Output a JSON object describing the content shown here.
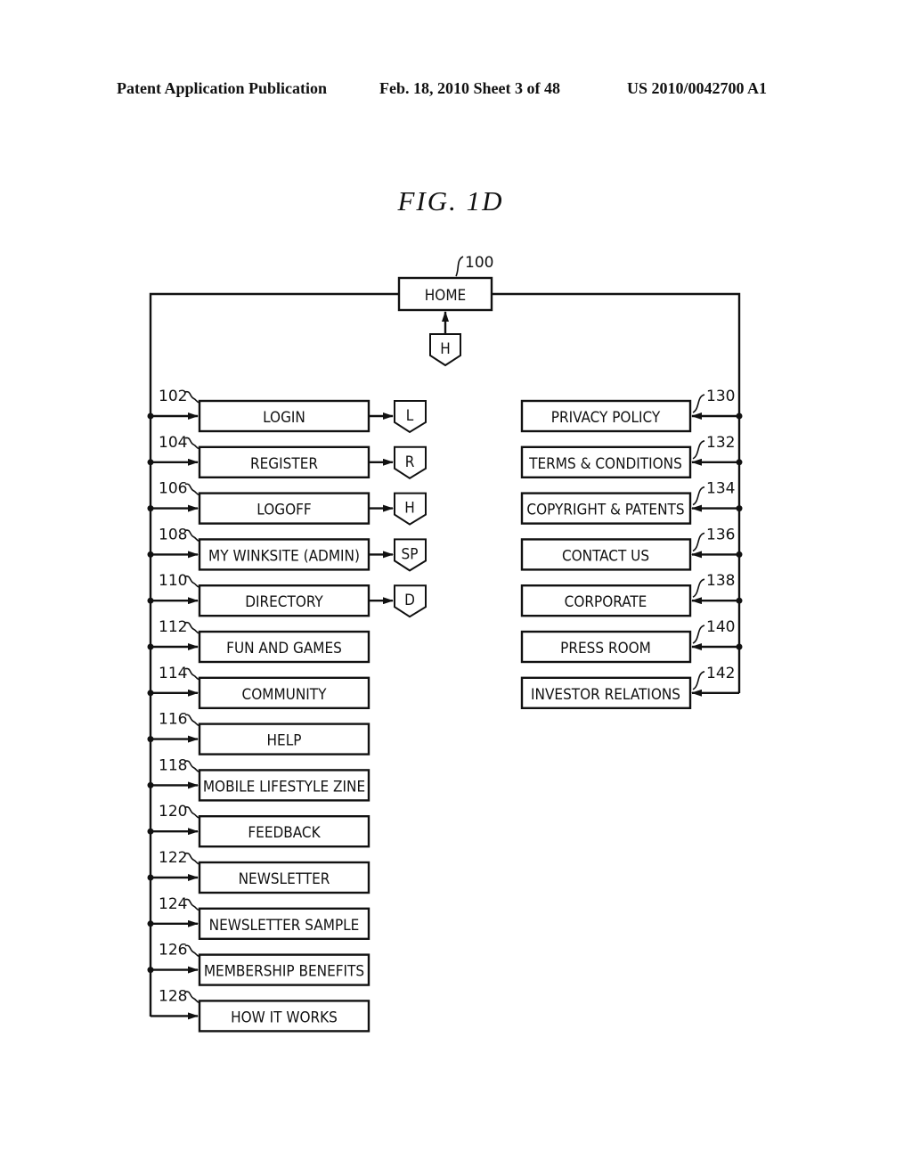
{
  "header": {
    "left": "Patent Application Publication",
    "center": "Feb. 18, 2010   Sheet 3 of 48",
    "right": "US 2010/0042700 A1"
  },
  "figure": {
    "title": "FIG.  1D",
    "root": {
      "ref": "100",
      "label": "HOME",
      "connector": "H"
    },
    "left_items": [
      {
        "ref": "102",
        "label": "LOGIN",
        "connector": "L"
      },
      {
        "ref": "104",
        "label": "REGISTER",
        "connector": "R"
      },
      {
        "ref": "106",
        "label": "LOGOFF",
        "connector": "H"
      },
      {
        "ref": "108",
        "label": "MY WINKSITE (ADMIN)",
        "connector": "SP"
      },
      {
        "ref": "110",
        "label": "DIRECTORY",
        "connector": "D"
      },
      {
        "ref": "112",
        "label": "FUN AND GAMES"
      },
      {
        "ref": "114",
        "label": "COMMUNITY"
      },
      {
        "ref": "116",
        "label": "HELP"
      },
      {
        "ref": "118",
        "label": "MOBILE LIFESTYLE ZINE"
      },
      {
        "ref": "120",
        "label": "FEEDBACK"
      },
      {
        "ref": "122",
        "label": "NEWSLETTER"
      },
      {
        "ref": "124",
        "label": "NEWSLETTER SAMPLE"
      },
      {
        "ref": "126",
        "label": "MEMBERSHIP BENEFITS"
      },
      {
        "ref": "128",
        "label": "HOW IT WORKS"
      }
    ],
    "right_items": [
      {
        "ref": "130",
        "label": "PRIVACY POLICY"
      },
      {
        "ref": "132",
        "label": "TERMS & CONDITIONS"
      },
      {
        "ref": "134",
        "label": "COPYRIGHT & PATENTS"
      },
      {
        "ref": "136",
        "label": "CONTACT US"
      },
      {
        "ref": "138",
        "label": "CORPORATE"
      },
      {
        "ref": "140",
        "label": "PRESS ROOM"
      },
      {
        "ref": "142",
        "label": "INVESTOR RELATIONS"
      }
    ]
  }
}
